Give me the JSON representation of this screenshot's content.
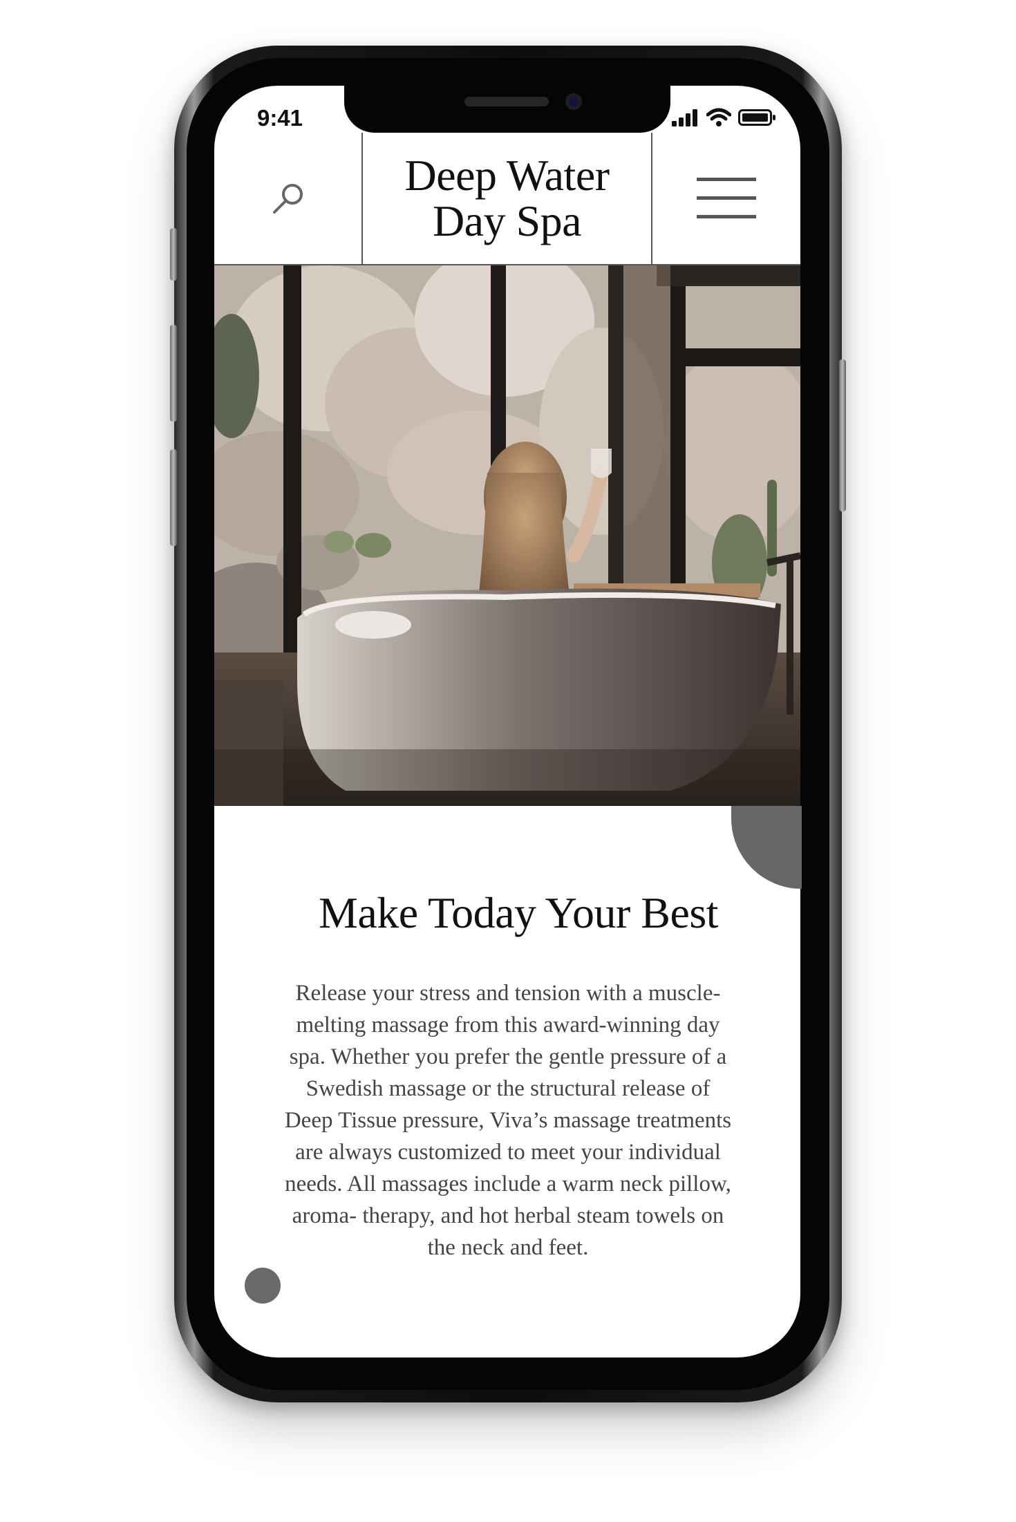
{
  "status_bar": {
    "time": "9:41"
  },
  "header": {
    "brand_line1": "Deep Water",
    "brand_line2": "Day Spa",
    "search_icon": "search-icon",
    "menu_icon": "hamburger-menu-icon"
  },
  "hero": {
    "image": "woman-in-bathtub-photo"
  },
  "content": {
    "headline": "Make Today Your Best",
    "body": "Release your stress and tension with a muscle-melting massage from this award-winning day spa. Whether you prefer the gentle pressure of a Swedish massage or the structural release of Deep Tissue pressure, Viva’s massage treatments are always customized to meet your individual needs. All massages include a warm neck pillow, aroma- therapy, and hot herbal steam towels on the neck and feet."
  },
  "colors": {
    "accent_gray": "#676767",
    "text_dark": "#111111",
    "text_body": "#444444"
  }
}
